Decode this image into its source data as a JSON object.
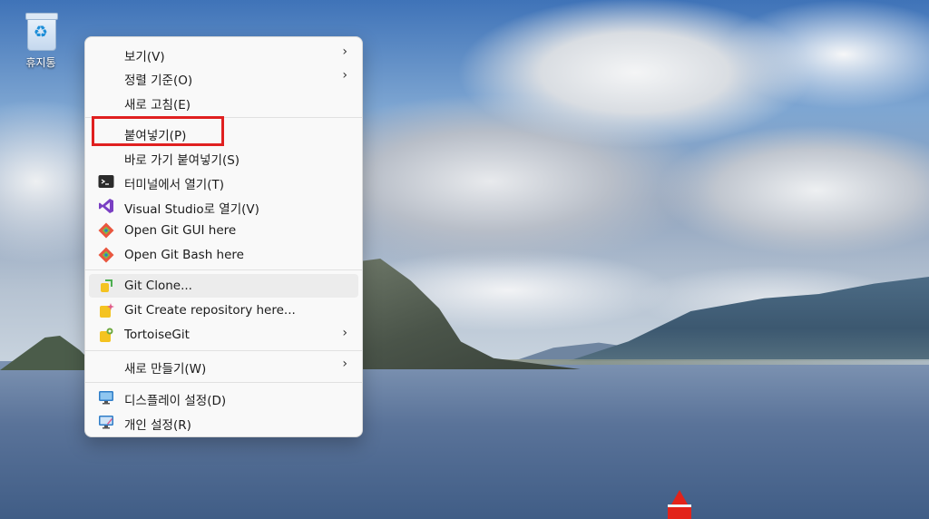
{
  "desktop": {
    "recycle_bin_label": "휴지통"
  },
  "context_menu": {
    "items": [
      {
        "label": "보기(V)",
        "submenu": true,
        "icon": "none"
      },
      {
        "label": "정렬 기준(O)",
        "submenu": true,
        "icon": "none"
      },
      {
        "label": "새로 고침(E)",
        "submenu": false,
        "icon": "none"
      },
      {
        "label": "붙여넣기(P)",
        "submenu": false,
        "icon": "none",
        "highlighted": true
      },
      {
        "label": "바로 가기 붙여넣기(S)",
        "submenu": false,
        "icon": "none"
      },
      {
        "label": "터미널에서 열기(T)",
        "submenu": false,
        "icon": "terminal-icon"
      },
      {
        "label": "Visual Studio로 열기(V)",
        "submenu": false,
        "icon": "visual-studio-icon"
      },
      {
        "label": "Open Git GUI here",
        "submenu": false,
        "icon": "git-gui-icon"
      },
      {
        "label": "Open Git Bash here",
        "submenu": false,
        "icon": "git-bash-icon"
      },
      {
        "label": "Git Clone...",
        "submenu": false,
        "icon": "git-clone-icon",
        "hovered": true
      },
      {
        "label": "Git Create repository here...",
        "submenu": false,
        "icon": "git-create-repo-icon"
      },
      {
        "label": "TortoiseGit",
        "submenu": true,
        "icon": "tortoisegit-icon"
      },
      {
        "label": "새로 만들기(W)",
        "submenu": true,
        "icon": "none"
      },
      {
        "label": "디스플레이 설정(D)",
        "submenu": false,
        "icon": "display-settings-icon"
      },
      {
        "label": "개인 설정(R)",
        "submenu": false,
        "icon": "personalize-icon"
      }
    ],
    "submenu_arrow": "›"
  },
  "colors": {
    "highlight_border": "#e02020",
    "menu_background": "#f9f9f9",
    "hover_background": "#ececec"
  }
}
